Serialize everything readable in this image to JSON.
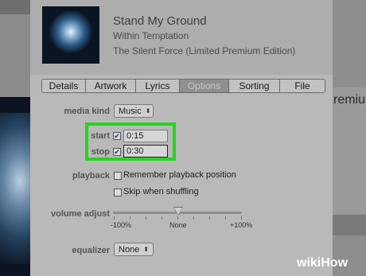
{
  "track": {
    "title": "Stand My Ground",
    "artist": "Within Temptation",
    "album": "The Silent Force (Limited Premium Edition)"
  },
  "tabs": [
    "Details",
    "Artwork",
    "Lyrics",
    "Options",
    "Sorting",
    "File"
  ],
  "active_tab": "Options",
  "options": {
    "media_kind": {
      "label": "media kind",
      "value": "Music"
    },
    "start": {
      "label": "start",
      "checked": true,
      "value": "0:15"
    },
    "stop": {
      "label": "stop",
      "checked": true,
      "value": "0:30"
    },
    "playback": {
      "label": "playback",
      "remember": {
        "text": "Remember playback position",
        "checked": false
      },
      "skip": {
        "text": "Skip when shuffling",
        "checked": false
      }
    },
    "volume": {
      "label": "volume adjust",
      "min_label": "-100%",
      "mid_label": "None",
      "max_label": "+100%",
      "level": 0
    },
    "equalizer": {
      "label": "equalizer",
      "value": "None"
    }
  },
  "background": {
    "partial_text": "remiu"
  },
  "watermark": {
    "wiki": "wiki",
    "how": "How"
  },
  "colors": {
    "highlight": "#22d61a"
  }
}
